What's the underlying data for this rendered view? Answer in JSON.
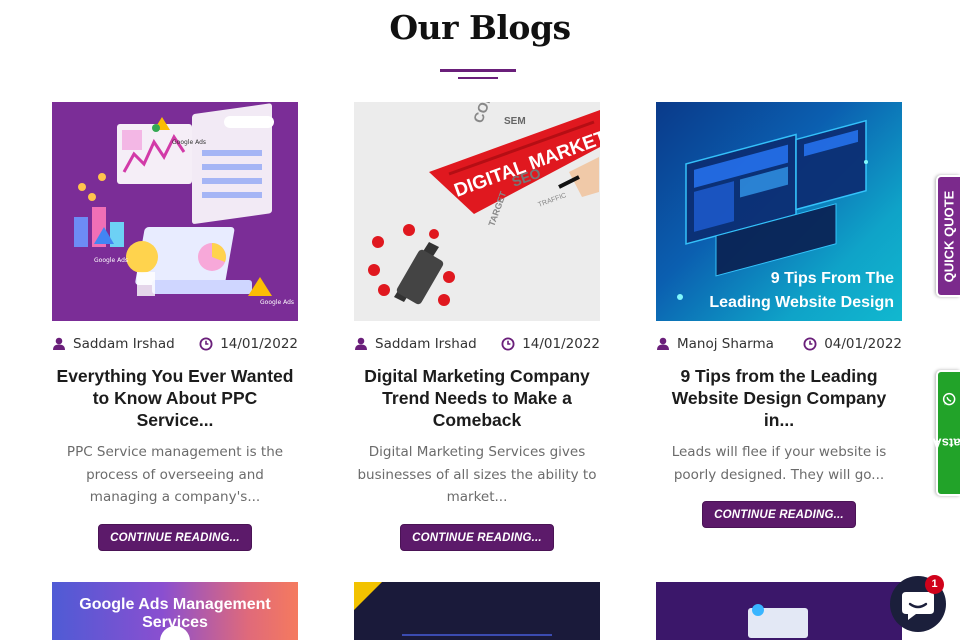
{
  "section": {
    "title": "Our Blogs"
  },
  "posts": [
    {
      "author": "Saddam Irshad",
      "date": "14/01/2022",
      "title": "Everything You Ever Wanted to Know About PPC Service...",
      "excerpt": "PPC Service management is the process of overseeing and managing a company's...",
      "button": "CONTINUE READING...",
      "image_labels": [
        "Google Ads",
        "Google Ads",
        "Google Ads"
      ]
    },
    {
      "author": "Saddam Irshad",
      "date": "14/01/2022",
      "title": "Digital Marketing Company Trend Needs to Make a Comeback",
      "excerpt": "Digital Marketing Services gives businesses of all sizes the ability to market...",
      "button": "CONTINUE READING...",
      "image_labels": [
        "DIGITAL MARKETING",
        "CONTENT",
        "SEM",
        "SEO",
        "TARGET",
        "TRAFFIC"
      ]
    },
    {
      "author": "Manoj Sharma",
      "date": "04/01/2022",
      "title": "9 Tips from the Leading Website Design Company in...",
      "excerpt": "Leads will flee if your website is poorly designed. They will go...",
      "button": "CONTINUE READING...",
      "image_labels": [
        "9 Tips From The",
        "Leading Website Design"
      ]
    }
  ],
  "next_row": {
    "first_image_label": "Google Ads Management Services"
  },
  "side_tabs": {
    "quote": "QUICK QUOTE",
    "whatsapp": "WhatsApp"
  },
  "chat": {
    "badge": "1"
  },
  "colors": {
    "brand_purple": "#5c1a6a",
    "whatsapp_green": "#22a329"
  },
  "icons": {
    "author": "user-icon",
    "date": "clock-icon",
    "chat": "chat-bubble-icon"
  }
}
